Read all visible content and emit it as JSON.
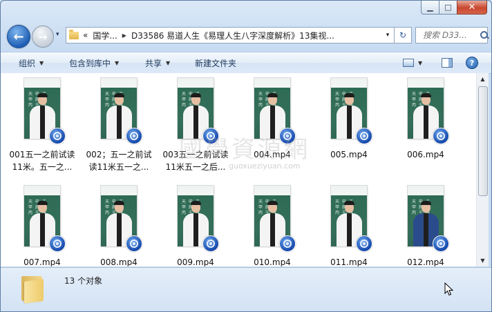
{
  "window": {
    "caption": {
      "minimize": "▁",
      "maximize": "□",
      "close": "✕"
    }
  },
  "nav": {
    "back_glyph": "←",
    "forward_glyph": "→",
    "history_glyph": "▾",
    "breadcrumb_prefix": "«",
    "breadcrumb": [
      "国学...",
      "D33586 易道人生《易理人生八字深度解析》13集视..."
    ],
    "address_drop_glyph": "▾",
    "refresh_glyph": "↻"
  },
  "search": {
    "placeholder": "搜索 D33..."
  },
  "toolbar": {
    "organize": "组织",
    "include_in_library": "包含到库中",
    "share": "共享",
    "new_folder": "新建文件夹",
    "help": "?"
  },
  "files": [
    {
      "name": "001五一之前试读11米。五一之...",
      "line1": "001五一之前试读",
      "line2": "11米。五一之..."
    },
    {
      "name": "002；五一之前试读11米五一之...",
      "line1": "002；五一之前试",
      "line2": "读11米五一之..."
    },
    {
      "name": "003五一之前试读11米五一之后...",
      "line1": "003五一之前试读",
      "line2": "11米五一之后..."
    },
    {
      "name": "004.mp4",
      "line1": "004.mp4",
      "line2": ""
    },
    {
      "name": "005.mp4",
      "line1": "005.mp4",
      "line2": ""
    },
    {
      "name": "006.mp4",
      "line1": "006.mp4",
      "line2": ""
    },
    {
      "name": "007.mp4",
      "line1": "007.mp4",
      "line2": ""
    },
    {
      "name": "008.mp4",
      "line1": "008.mp4",
      "line2": ""
    },
    {
      "name": "009.mp4",
      "line1": "009.mp4",
      "line2": ""
    },
    {
      "name": "010.mp4",
      "line1": "010.mp4",
      "line2": ""
    },
    {
      "name": "011.mp4",
      "line1": "011.mp4",
      "line2": ""
    },
    {
      "name": "012.mp4",
      "line1": "012.mp4",
      "line2": ""
    }
  ],
  "status": {
    "count": "13 个对象"
  },
  "watermark": {
    "text": "國學資源網",
    "url": "guoxueziyuan.com"
  }
}
